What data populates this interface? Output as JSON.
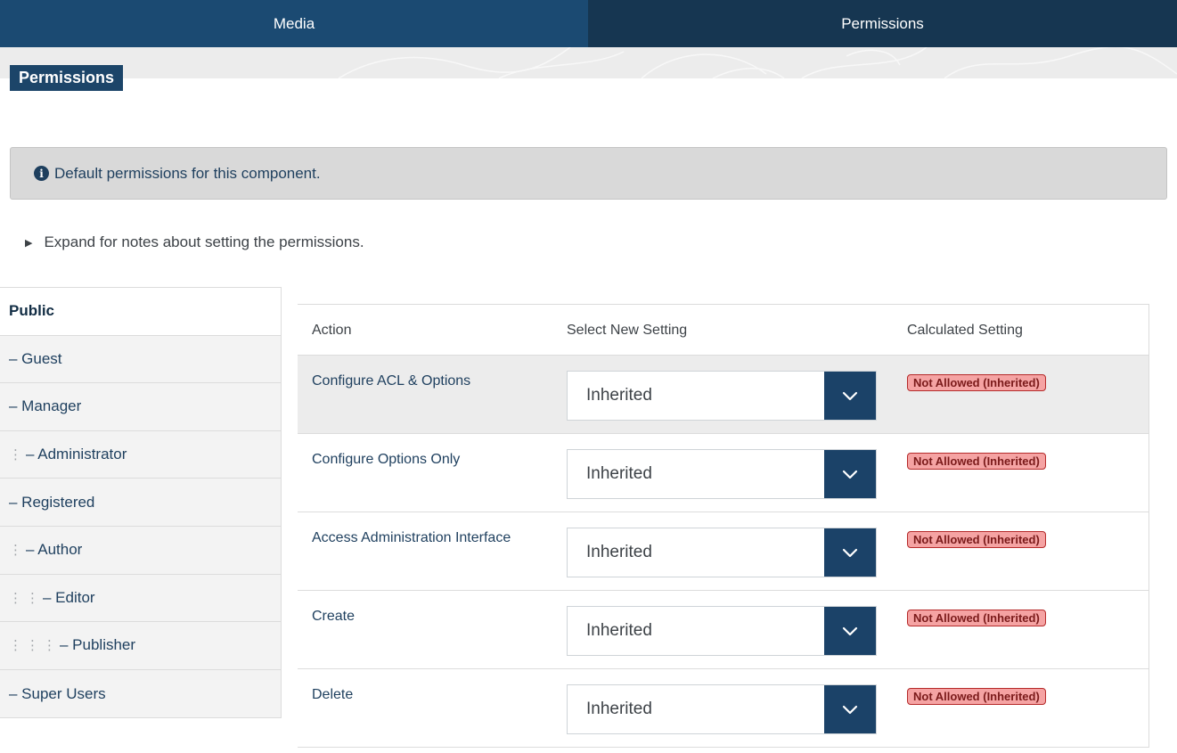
{
  "tabs": [
    {
      "label": "Media"
    },
    {
      "label": "Permissions"
    }
  ],
  "heading": "Permissions",
  "alert": {
    "icon": "info-circle-icon",
    "text": "Default permissions for this component."
  },
  "expander": {
    "icon": "triangle-right-icon",
    "text": "Expand for notes about setting the permissions."
  },
  "groups": [
    {
      "label": "Public",
      "depth": 0,
      "active": true
    },
    {
      "label": "– Guest",
      "depth": 0
    },
    {
      "label": "– Manager",
      "depth": 0
    },
    {
      "label": "– Administrator",
      "depth": 1
    },
    {
      "label": "– Registered",
      "depth": 0
    },
    {
      "label": "– Author",
      "depth": 1
    },
    {
      "label": "– Editor",
      "depth": 2
    },
    {
      "label": "– Publisher",
      "depth": 3
    },
    {
      "label": "– Super Users",
      "depth": 0
    }
  ],
  "table": {
    "headers": {
      "action": "Action",
      "select": "Select New Setting",
      "calculated": "Calculated Setting"
    },
    "rows": [
      {
        "action": "Configure ACL & Options",
        "setting": "Inherited",
        "calculated": "Not Allowed (Inherited)"
      },
      {
        "action": "Configure Options Only",
        "setting": "Inherited",
        "calculated": "Not Allowed (Inherited)"
      },
      {
        "action": "Access Administration Interface",
        "setting": "Inherited",
        "calculated": "Not Allowed (Inherited)"
      },
      {
        "action": "Create",
        "setting": "Inherited",
        "calculated": "Not Allowed (Inherited)"
      },
      {
        "action": "Delete",
        "setting": "Inherited",
        "calculated": "Not Allowed (Inherited)"
      }
    ]
  },
  "colors": {
    "primary": "#1b4a72",
    "primary_dark": "#163651",
    "badge_bg": "#f5a3a3",
    "badge_border": "#b52a2a"
  }
}
